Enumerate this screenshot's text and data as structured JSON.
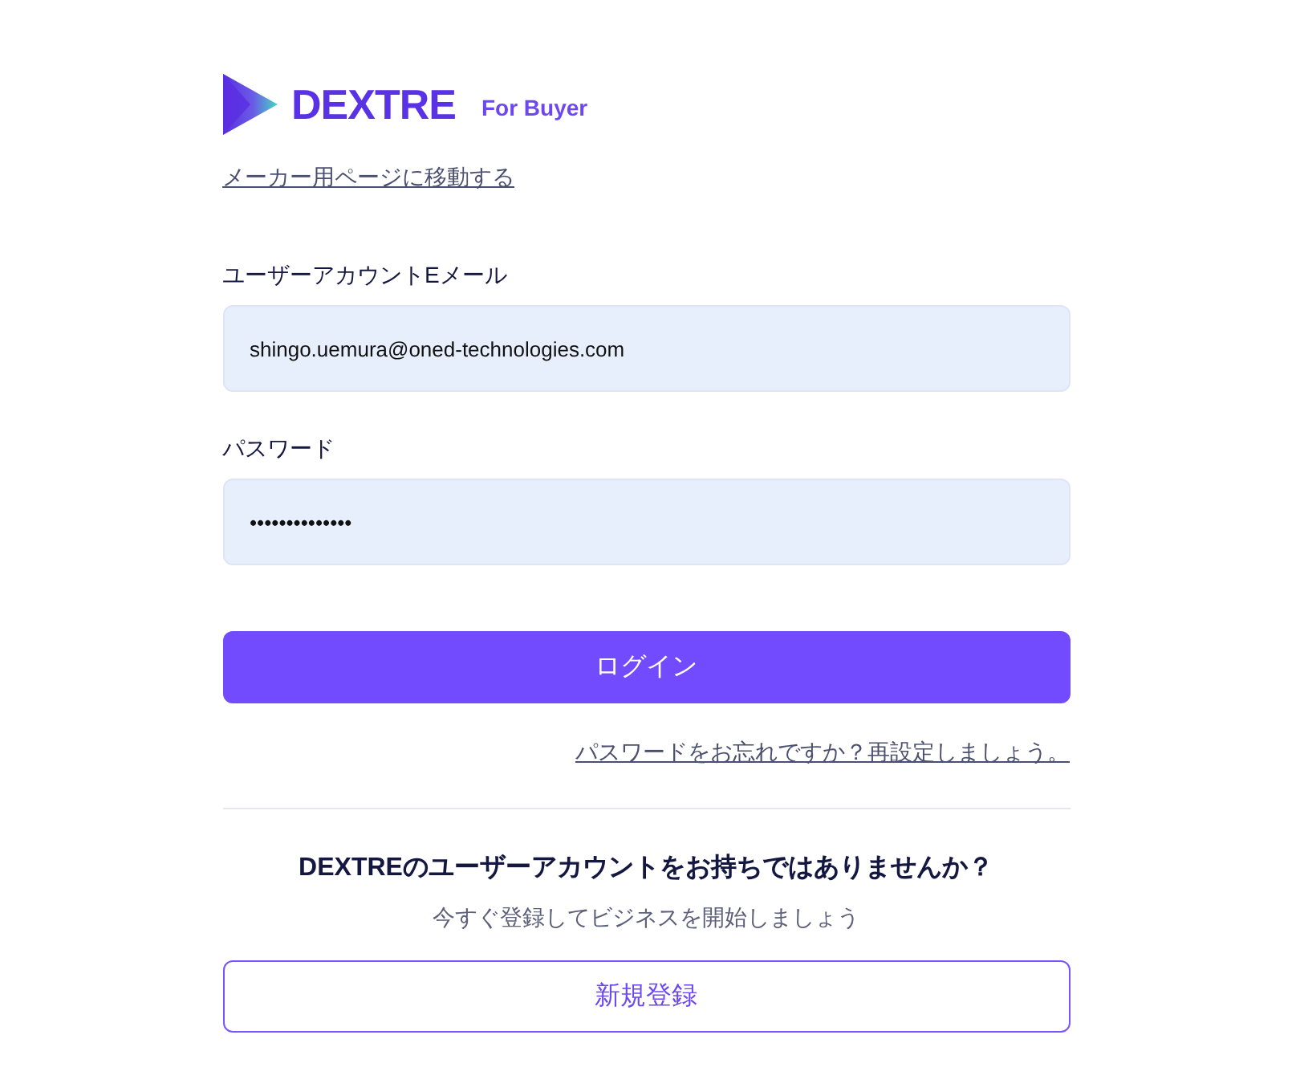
{
  "logo": {
    "wordmark": "DEXTRE",
    "tagline": "For Buyer"
  },
  "maker_link": "メーカー用ページに移動する",
  "fields": [
    {
      "label": "ユーザーアカウントEメール",
      "value": "shingo.uemura@oned-technologies.com"
    },
    {
      "label": "パスワード",
      "value": "••••••••••••••"
    }
  ],
  "login_button": "ログイン",
  "forgot_link": "パスワードをお忘れですか？再設定しましょう。",
  "signup": {
    "heading": "DEXTREのユーザーアカウントをお持ちではありませんか？",
    "subtext": "今すぐ登録してビジネスを開始しましょう",
    "button": "新規登録"
  }
}
